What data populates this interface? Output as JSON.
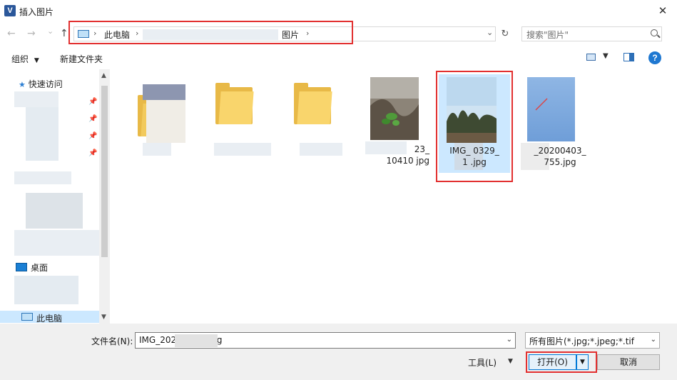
{
  "window": {
    "title": "插入图片",
    "app_icon": "V",
    "close": "✕"
  },
  "navigation": {
    "back": "←",
    "forward": "→",
    "recent": "⌄",
    "up": "↑"
  },
  "address_bar": {
    "crumbs": [
      "此电脑",
      "图片"
    ],
    "separator": "›",
    "refresh": "↻"
  },
  "search": {
    "placeholder": "搜索\"图片\""
  },
  "toolbar": {
    "organize": "组织",
    "organize_caret": "▼",
    "new_folder": "新建文件夹",
    "view_caret": "▼",
    "help": "?"
  },
  "sidebar": {
    "quick_access": "快速访问",
    "desktop": "桌面",
    "this_pc": "此电脑",
    "pin": "📌"
  },
  "files": [
    {
      "label_line1": "",
      "label_line2": "",
      "type": "folder-blurred"
    },
    {
      "label_line1": "",
      "label_line2": "",
      "type": "folder"
    },
    {
      "label_line1": "",
      "label_line2": "",
      "type": "folder"
    },
    {
      "label_line1": "23_",
      "label_line2": "10410 jpg",
      "type": "image-plant"
    },
    {
      "label_line1": "IMG_  0329_",
      "label_line2": "1  .jpg",
      "type": "image-trees",
      "selected": true
    },
    {
      "label_line1": "_20200403_",
      "label_line2": "755.jpg",
      "type": "image-sky"
    }
  ],
  "footer": {
    "filename_label": "文件名(N):",
    "filename_value": "IMG_202        11610.jpg",
    "filetype_value": "所有图片(*.jpg;*.jpeg;*.tif",
    "tools": "工具(L)",
    "open": "打开(O)",
    "cancel": "取消",
    "dropdown": "▼"
  }
}
